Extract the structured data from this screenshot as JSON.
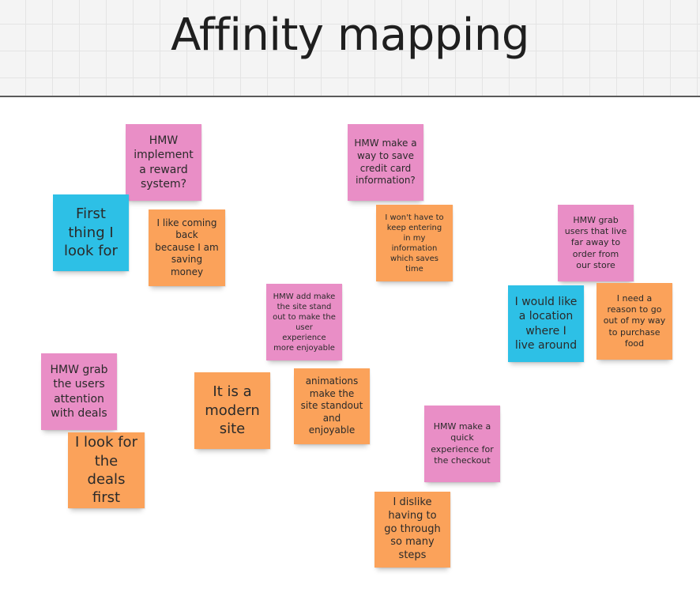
{
  "title": "Affinity mapping",
  "colors": {
    "pink": "#e98ec6",
    "orange": "#fba25a",
    "cyan": "#2dc0e6"
  },
  "notes": {
    "n1": {
      "text": "HMW implement a reward system?",
      "color": "pink"
    },
    "n2": {
      "text": "First thing I look for",
      "color": "cyan"
    },
    "n3": {
      "text": "I like coming back because I am saving money",
      "color": "orange"
    },
    "n4": {
      "text": "HMW make a way to save credit card information?",
      "color": "pink"
    },
    "n5": {
      "text": "I won't have to keep entering in my information which saves time",
      "color": "orange"
    },
    "n6": {
      "text": "HMW grab users that live far away to order from our store",
      "color": "pink"
    },
    "n7": {
      "text": "I would like a location where I live around",
      "color": "cyan"
    },
    "n8": {
      "text": "I need a reason to go out of my way to purchase food",
      "color": "orange"
    },
    "n9": {
      "text": "HMW add make the site stand out to make the user experience more enjoyable",
      "color": "pink"
    },
    "n10": {
      "text": "It is a modern site",
      "color": "orange"
    },
    "n11": {
      "text": "animations make the site standout and enjoyable",
      "color": "orange"
    },
    "n12": {
      "text": "HMW grab the users attention with deals",
      "color": "pink"
    },
    "n13": {
      "text": "I look for the deals first",
      "color": "orange"
    },
    "n14": {
      "text": "HMW make a quick experience for the checkout",
      "color": "pink"
    },
    "n15": {
      "text": "I dislike having to go through so many steps",
      "color": "orange"
    }
  }
}
